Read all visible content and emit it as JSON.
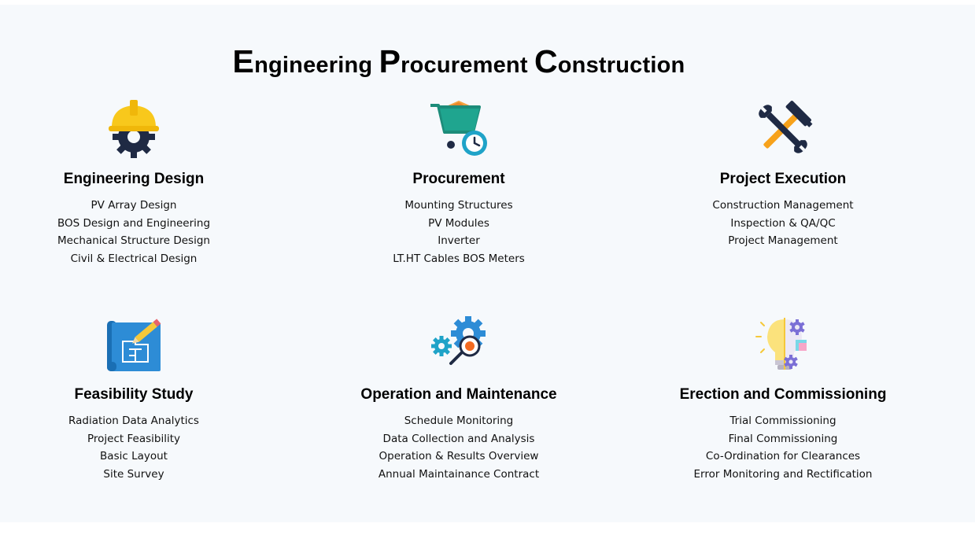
{
  "title": {
    "e_cap": "E",
    "e_rest": "ngineering ",
    "p_cap": "P",
    "p_rest": "rocurement ",
    "c_cap": "C",
    "c_rest": "onstruction"
  },
  "cards": [
    {
      "icon": "engineer-helmet-gear-icon",
      "title": "Engineering Design",
      "items": [
        "PV Array Design",
        "BOS Design and Engineering",
        "Mechanical Structure Design",
        "Civil & Electrical Design"
      ]
    },
    {
      "icon": "cart-clock-icon",
      "title": "Procurement",
      "items": [
        "Mounting Structures",
        "PV Modules",
        "Inverter",
        "LT.HT Cables BOS Meters"
      ]
    },
    {
      "icon": "hammer-wrench-icon",
      "title": "Project Execution",
      "items": [
        "Construction Management",
        "Inspection & QA/QC",
        "Project Management"
      ]
    },
    {
      "icon": "blueprint-pencil-icon",
      "title": "Feasibility Study",
      "items": [
        "Radiation Data Analytics",
        "Project Feasibility",
        "Basic Layout",
        "Site Survey"
      ]
    },
    {
      "icon": "gears-magnifier-icon",
      "title": "Operation and Maintenance",
      "items": [
        "Schedule Monitoring",
        "Data Collection and Analysis",
        "Operation & Results Overview",
        "Annual Maintainance Contract"
      ]
    },
    {
      "icon": "bulb-gears-icon",
      "title": "Erection and Commissioning",
      "items": [
        "Trial Commissioning",
        "Final Commissioning",
        "Co-Ordination for Clearances",
        "Error Monitoring and Rectification"
      ]
    }
  ]
}
